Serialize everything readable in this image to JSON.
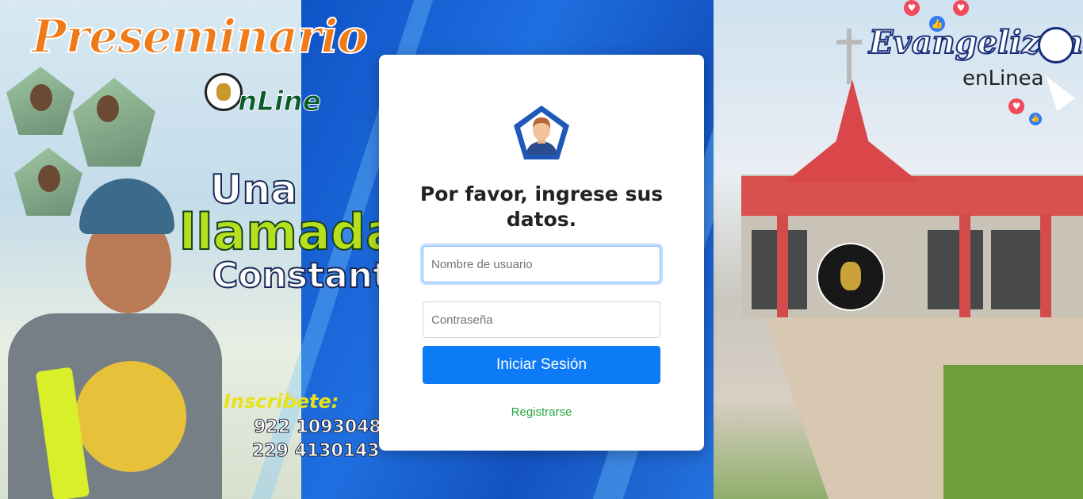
{
  "banner": {
    "left": {
      "title": "Preseminario",
      "subtitle": "nLine",
      "slogan_line1": "Una",
      "slogan_line2": "llamada",
      "slogan_line3": "Constante",
      "inscribete": "Inscribete:",
      "phone_1": "922 1093048",
      "phone_2": "229 4130143"
    },
    "right": {
      "title": "Evangelizand",
      "subtitle": "enLinea"
    },
    "colors": {
      "blue_band": "#1d5fc8",
      "orange_title": "#f07a18",
      "green_title": "#b6e01e",
      "church_red": "#d9474a"
    }
  },
  "login": {
    "avatar_icon": "user-avatar-pentagon",
    "heading": "Por favor, ingrese sus datos.",
    "username_placeholder": "Nombre de usuario",
    "username_value": "",
    "password_placeholder": "Contraseña",
    "password_value": "",
    "submit_label": "Iniciar Sesión",
    "register_label": "Registrarse",
    "colors": {
      "button": "#0d7af6",
      "link": "#28a745",
      "focus_border": "#80bdff"
    }
  }
}
